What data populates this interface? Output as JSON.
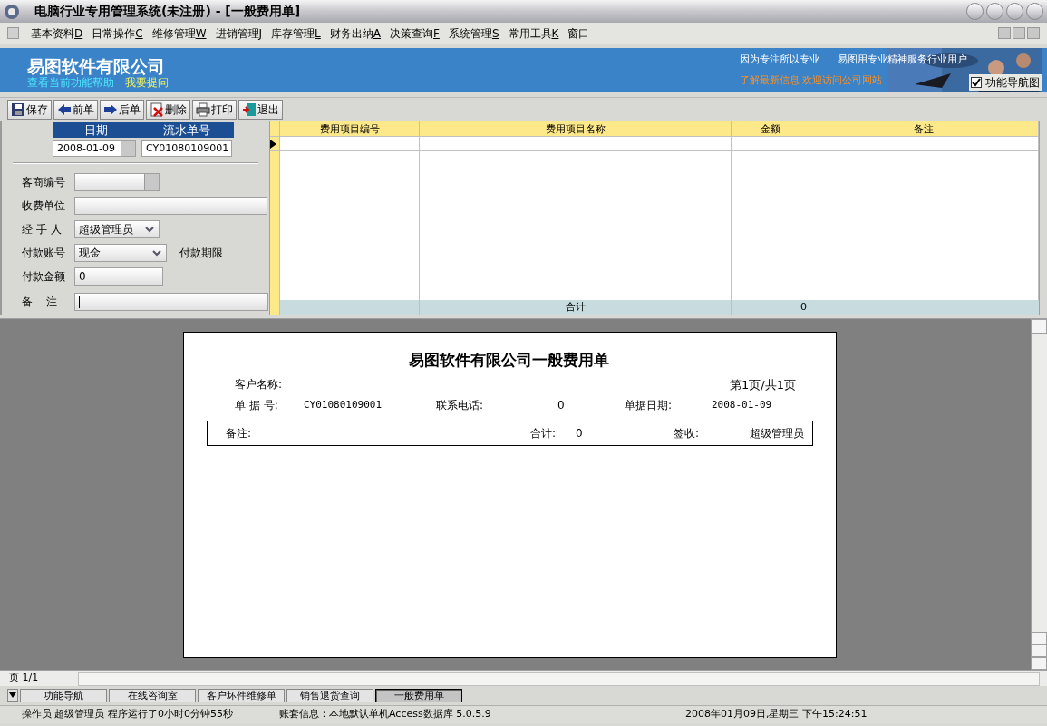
{
  "window": {
    "title": "电脑行业专用管理系统(未注册) - [一般费用单]"
  },
  "menu": [
    {
      "label": "基本资料",
      "key": "D"
    },
    {
      "label": "日常操作",
      "key": "C"
    },
    {
      "label": "维修管理",
      "key": "W"
    },
    {
      "label": "进销管理",
      "key": "J"
    },
    {
      "label": "库存管理",
      "key": "L"
    },
    {
      "label": "财务出纳",
      "key": "A"
    },
    {
      "label": "决策查询",
      "key": "F"
    },
    {
      "label": "系统管理",
      "key": "S"
    },
    {
      "label": "常用工具",
      "key": "K"
    },
    {
      "label": "窗口"
    }
  ],
  "banner": {
    "company": "易图软件有限公司",
    "help_link": "查看当前功能帮助",
    "ask_link": "我要提问",
    "slogan_1": "因为专注所以专业",
    "slogan_2": "易图用专业精神服务行业用户",
    "news": "了解最新信息  欢迎访问公司网站",
    "nav_checkbox": {
      "label": "功能导航图",
      "checked": true
    }
  },
  "toolbar": [
    {
      "kind": "save",
      "label": "保存"
    },
    {
      "kind": "prev",
      "label": "前单"
    },
    {
      "kind": "next",
      "label": "后单"
    },
    {
      "kind": "delete",
      "label": "删除"
    },
    {
      "kind": "print",
      "label": "打印"
    },
    {
      "kind": "exit",
      "label": "退出"
    }
  ],
  "header": {
    "date_label": "日期",
    "date": "2008-01-09",
    "serial_label": "流水单号",
    "serial": "CY01080109001"
  },
  "form": [
    {
      "kind": "lookup",
      "label": "客商编号"
    },
    {
      "kind": "text",
      "label": "收费单位"
    },
    {
      "kind": "select",
      "label": "经 手 人",
      "value": "超级管理员"
    },
    {
      "kind": "select",
      "label": "付款账号",
      "value": "现金",
      "aside": "付款期限"
    },
    {
      "kind": "short",
      "label": "付款金额",
      "value": "0"
    },
    {
      "kind": "memo",
      "label": "备    注"
    }
  ],
  "grid": {
    "columns": [
      "费用项目编号",
      "费用项目名称",
      "金额",
      "备注"
    ],
    "footer": {
      "label": "合计",
      "amount": "0"
    }
  },
  "report": {
    "title": "易图软件有限公司一般费用单",
    "customer_label": "客户名称:",
    "page_info": "第1页/共1页",
    "doc_no_label": "单 据 号:",
    "doc_no": "CY01080109001",
    "phone_label": "联系电话:",
    "phone": "0",
    "date_label": "单据日期:",
    "date": "2008-01-09",
    "remark_label": "备注:",
    "total_label": "合计:",
    "total": "0",
    "sign_label": "签收:",
    "signer": "超级管理员"
  },
  "pager": "页 1/1",
  "tabs": [
    {
      "label": "功能导航",
      "selected": false
    },
    {
      "label": "在线咨询室",
      "selected": false
    },
    {
      "label": "客户坏件维修单",
      "selected": false
    },
    {
      "label": "销售退货查询",
      "selected": false
    },
    {
      "label": "一般费用单",
      "selected": true
    }
  ],
  "status": {
    "operator": "操作员 超级管理员 程序运行了0小时0分钟55秒",
    "account": "账套信息：本地默认单机Access数据库 5.0.5.9",
    "datetime": "2008年01月09日,星期三  下午15:24:51"
  }
}
